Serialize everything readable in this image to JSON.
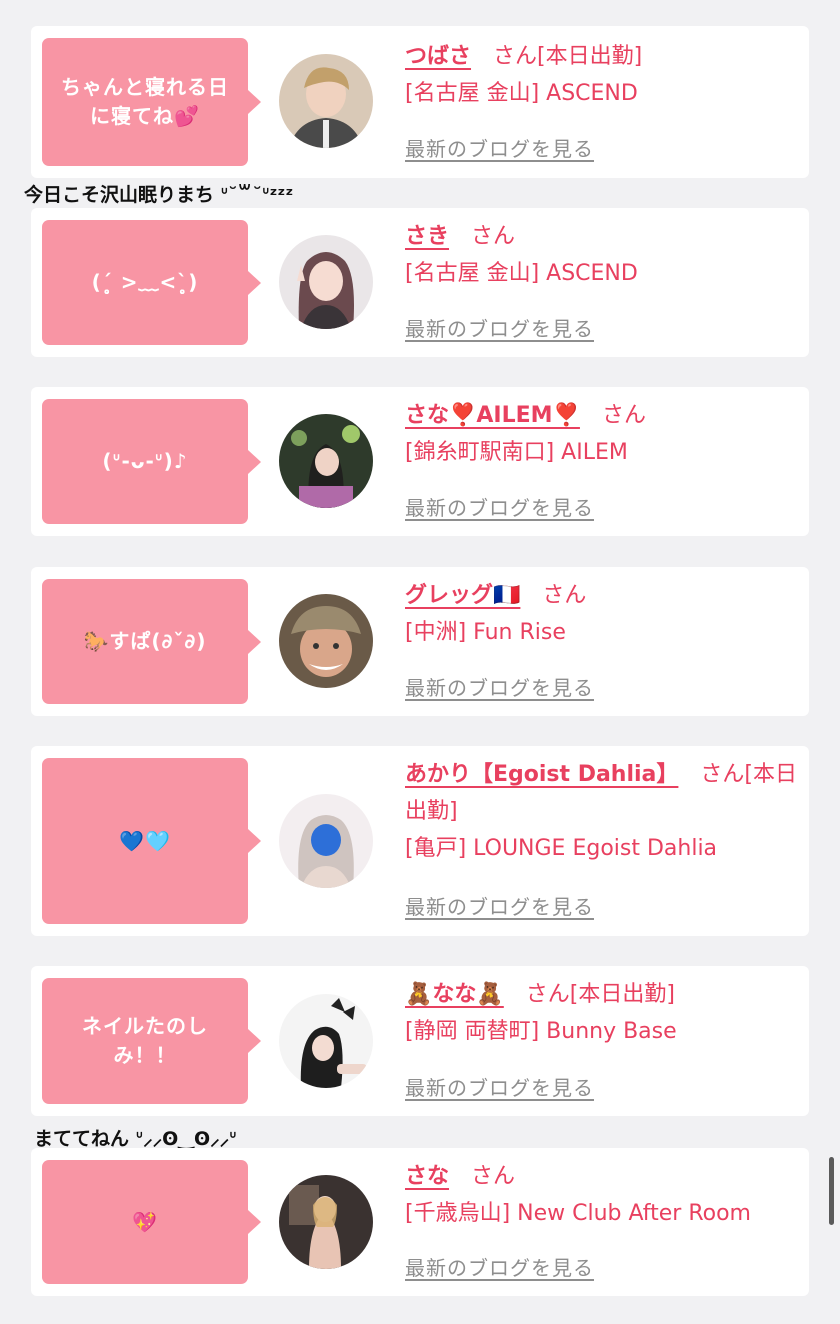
{
  "entries": [
    {
      "bubble": "ちゃんと寝れる日に寝てね💕",
      "name": "つばさ",
      "san": "さん[本日出勤]",
      "shop": "[名古屋 金山] ASCEND",
      "blog": "最新のブログを見る"
    },
    {
      "bubble": "(ˊ̥̥̥̥̥ >﹏<ˋ̥̥̥̥̥)",
      "name": "さき",
      "san": "さん",
      "shop": "[名古屋 金山] ASCEND",
      "blog": "最新のブログを見る"
    },
    {
      "bubble": "(ᐡ-ᴗ-ᐡ)♪",
      "name": "さな❣️AILEM❣️",
      "san": "さん",
      "shop": "[錦糸町駅南口] AILEM",
      "blog": "最新のブログを見る"
    },
    {
      "bubble": "🐎すぱ(∂ˇ∂)",
      "name": "グレッグ🇫🇷",
      "san": "さん",
      "shop": "[中洲] Fun Rise",
      "blog": "最新のブログを見る"
    },
    {
      "bubble": "💙🩵",
      "name": "あかり【Egoist Dahlia】",
      "san": "さん[本日出勤]",
      "shop": "[亀戸] LOUNGE Egoist Dahlia",
      "blog": "最新のブログを見る"
    },
    {
      "bubble": "ネイルたのしみ！！",
      "name": "🧸なな🧸",
      "san": "さん[本日出勤]",
      "shop": "[静岡 両替町] Bunny Base",
      "blog": "最新のブログを見る"
    },
    {
      "bubble": "💖",
      "name": "さな",
      "san": "さん",
      "shop": "[千歳烏山] New Club After Room",
      "blog": "最新のブログを見る"
    }
  ],
  "overflow_texts": [
    "今日こそ沢山眠りまち ᐡ˘꒳˘ᐡᶻᶻᶻ",
    "まててねん ᐡ⸝⸝ʘ‿ʘ⸝⸝ᐡ"
  ]
}
